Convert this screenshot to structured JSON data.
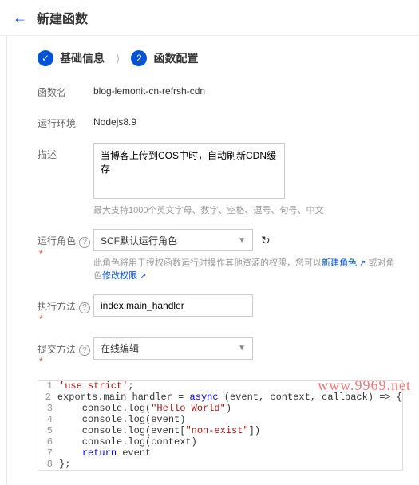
{
  "header": {
    "title": "新建函数"
  },
  "steps": {
    "step1": {
      "label": "基础信息"
    },
    "step2": {
      "num": "2",
      "label": "函数配置"
    }
  },
  "form": {
    "name": {
      "label": "函数名",
      "value": "blog-lemonit-cn-refrsh-cdn"
    },
    "runtime": {
      "label": "运行环境",
      "value": "Nodejs8.9"
    },
    "desc": {
      "label": "描述",
      "value": "当博客上传到COS中时，自动刷新CDN缓存",
      "hint": "最大支持1000个英文字母、数字、空格、逗号、句号、中文"
    },
    "role": {
      "label": "运行角色",
      "selected": "SCF默认运行角色",
      "hint_prefix": "此角色将用于授权函数运行时操作其他资源的权限，您可以",
      "link1": "新建角色",
      "hint_mid": " 或对角色",
      "link2": "修改权限"
    },
    "exec": {
      "label": "执行方法",
      "value": "index.main_handler"
    },
    "submit": {
      "label": "提交方法",
      "selected": "在线编辑"
    }
  },
  "code": {
    "l1a": "'use strict'",
    "l1b": ";",
    "l2a": "exports.main_handler = ",
    "l2b": "async",
    "l2c": " (event, context, callback) => {",
    "l3a": "    console.log(",
    "l3b": "\"Hello World\"",
    "l3c": ")",
    "l4": "    console.log(event)",
    "l5a": "    console.log(event[",
    "l5b": "\"non-exist\"",
    "l5c": "])",
    "l6": "    console.log(context)",
    "l7a": "    ",
    "l7b": "return",
    "l7c": " event",
    "l8": "};"
  },
  "watermark": "www.9969.net"
}
